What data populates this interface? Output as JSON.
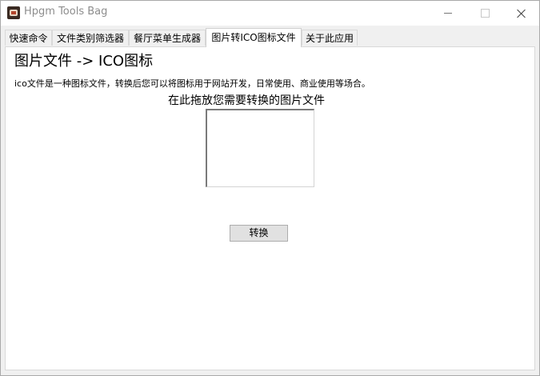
{
  "window": {
    "title": "Hpgm Tools Bag",
    "icon": "app-icon",
    "controls": [
      "minimize-icon",
      "maximize-icon",
      "close-icon"
    ]
  },
  "tabs": [
    {
      "label": "快速命令",
      "active": false
    },
    {
      "label": "文件类别筛选器",
      "active": false
    },
    {
      "label": "餐厅菜单生成器",
      "active": false
    },
    {
      "label": "图片转ICO图标文件",
      "active": true
    },
    {
      "label": "关于此应用",
      "active": false
    }
  ],
  "panel": {
    "heading": "图片文件 -> ICO图标",
    "description": "ico文件是一种图标文件，转换后您可以将图标用于网站开发，日常使用、商业使用等场合。",
    "drop_label": "在此拖放您需要转换的图片文件",
    "convert_label": "转换"
  }
}
